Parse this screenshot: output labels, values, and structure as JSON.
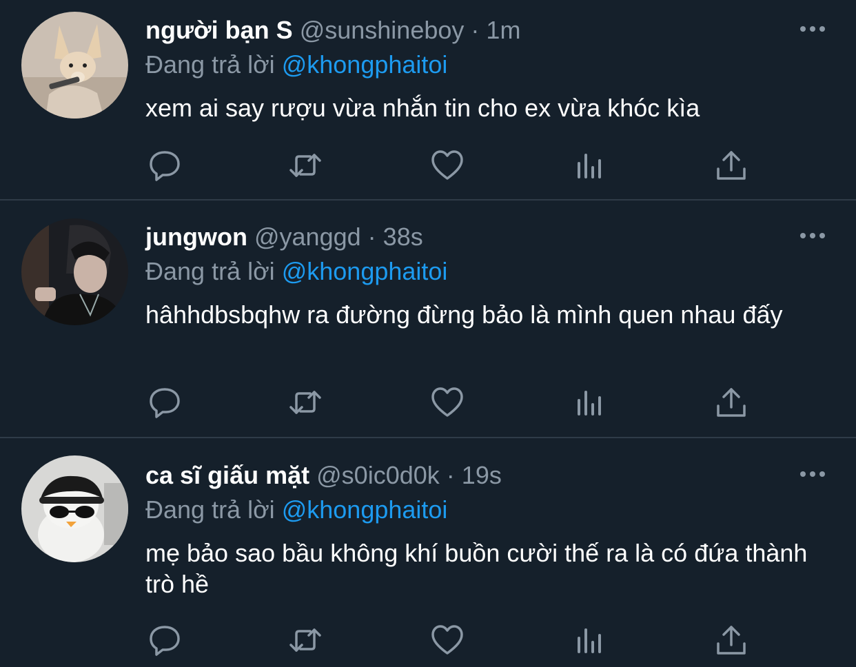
{
  "colors": {
    "background": "#15202b",
    "muted": "#8b98a5",
    "mention": "#1d9bf0",
    "divider": "#2f3b48"
  },
  "replies": [
    {
      "name": "người bạn S",
      "handle": "@sunshineboy",
      "separator": "·",
      "time": "1m",
      "reply_prefix": "Đang trả lời",
      "reply_to": "@khongphaitoi",
      "text": "xem ai say rượu vừa nhắn tin cho ex vừa khóc kìa",
      "avatar_icon": "fennec-fox-avatar"
    },
    {
      "name": "jungwon",
      "handle": "@yanggd",
      "separator": "·",
      "time": "38s",
      "reply_prefix": "Đang trả lời",
      "reply_to": "@khongphaitoi",
      "text": "hâhhdbsbqhw ra đường đừng bảo là mình quen nhau đấy",
      "avatar_icon": "person-photo-avatar"
    },
    {
      "name": "ca sĩ giấu mặt",
      "handle": "@s0ic0d0k",
      "separator": "·",
      "time": "19s",
      "reply_prefix": "Đang trả lời",
      "reply_to": "@khongphaitoi",
      "text": "mẹ bảo sao bầu không khí buồn cười thế ra là có đứa thành trò hề",
      "avatar_icon": "masked-figure-avatar"
    }
  ],
  "icons": [
    "more-icon",
    "reply-icon",
    "retweet-icon",
    "like-icon",
    "analytics-icon",
    "share-icon"
  ]
}
